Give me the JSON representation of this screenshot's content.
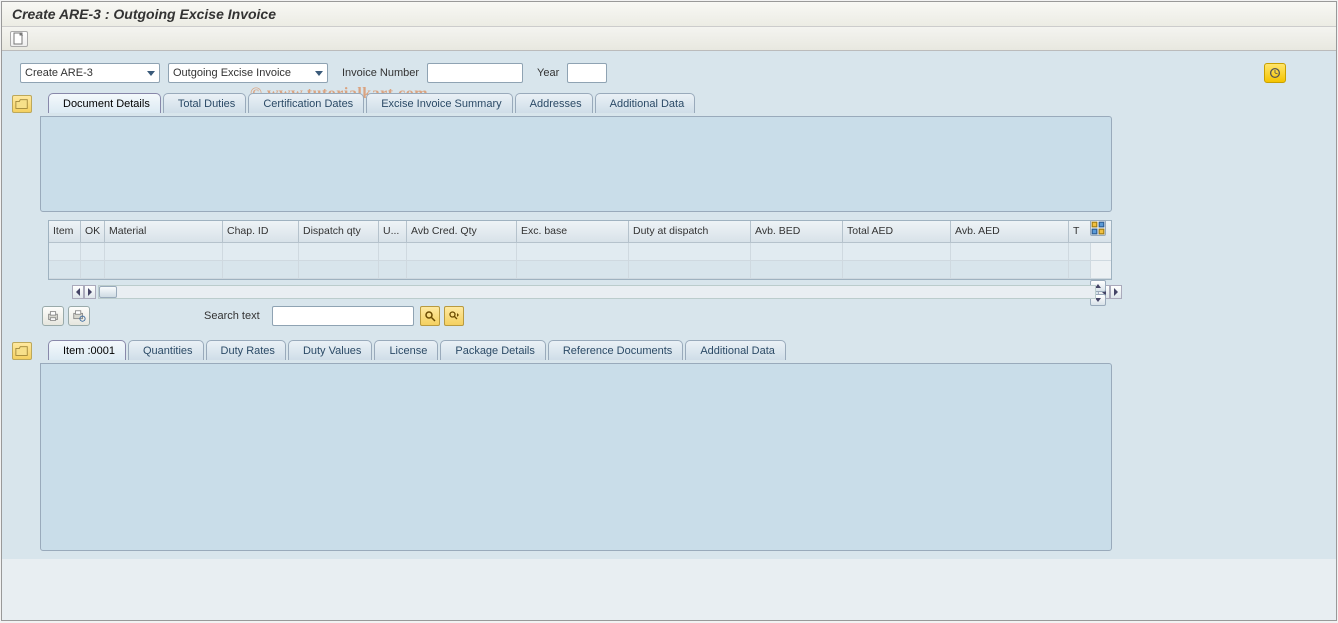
{
  "title": "Create ARE-3 : Outgoing Excise Invoice",
  "watermark": "© www.tutorialkart.com",
  "selectors": {
    "create_value": "Create ARE-3",
    "doc_type_value": "Outgoing Excise Invoice"
  },
  "fields": {
    "invoice_number_label": "Invoice Number",
    "invoice_number_value": "",
    "year_label": "Year",
    "year_value": ""
  },
  "tabs_top": [
    {
      "label": "Document Details",
      "active": true
    },
    {
      "label": "Total Duties"
    },
    {
      "label": "Certification Dates"
    },
    {
      "label": "Excise Invoice Summary"
    },
    {
      "label": "Addresses"
    },
    {
      "label": "Additional Data"
    }
  ],
  "chart_data": {
    "type": "table",
    "columns": [
      "Item",
      "OK",
      "Material",
      "Chap. ID",
      "Dispatch qty",
      "U...",
      "Avb Cred. Qty",
      "Exc. base",
      "Duty at dispatch",
      "Avb. BED",
      "Total AED",
      "Avb. AED",
      "T"
    ],
    "rows": [
      [
        "",
        "",
        "",
        "",
        "",
        "",
        "",
        "",
        "",
        "",
        "",
        "",
        ""
      ],
      [
        "",
        "",
        "",
        "",
        "",
        "",
        "",
        "",
        "",
        "",
        "",
        "",
        ""
      ]
    ]
  },
  "search": {
    "label": "Search text",
    "value": ""
  },
  "tabs_bottom": [
    {
      "label": "Item  :0001",
      "active": true
    },
    {
      "label": "Quantities"
    },
    {
      "label": "Duty Rates"
    },
    {
      "label": "Duty Values"
    },
    {
      "label": "License"
    },
    {
      "label": "Package Details"
    },
    {
      "label": "Reference Documents"
    },
    {
      "label": "Additional Data"
    }
  ]
}
